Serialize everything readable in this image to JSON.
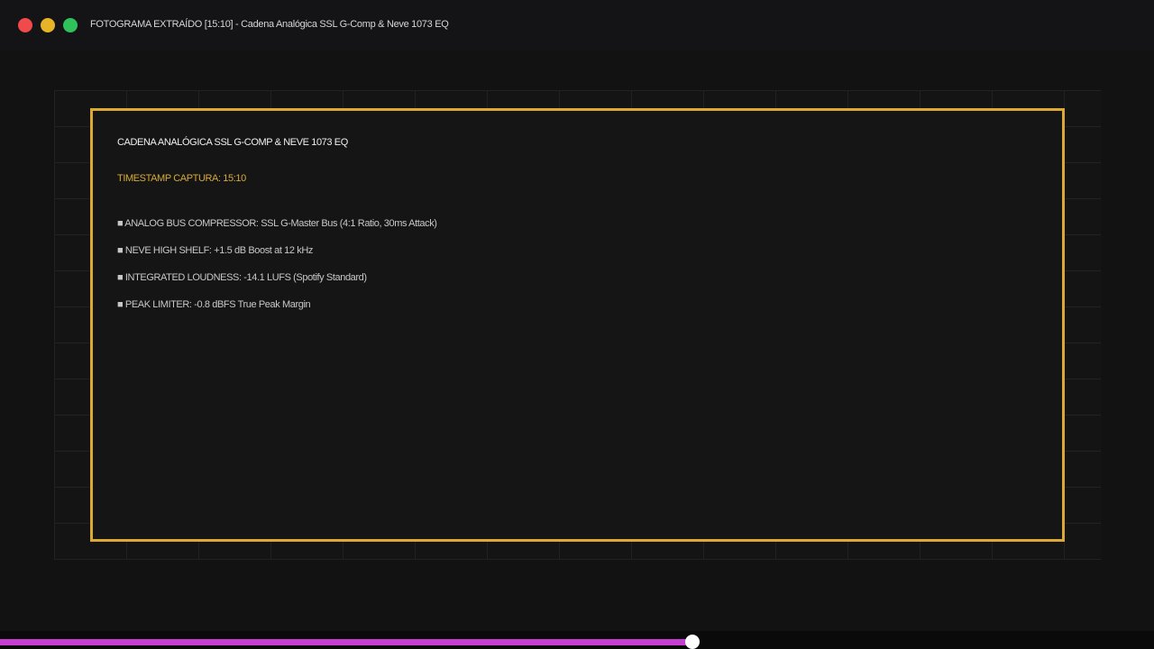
{
  "window": {
    "title": "FOTOGRAMA EXTRAÍDO [15:10] - Cadena Analógica SSL G-Comp & Neve 1073 EQ"
  },
  "frame": {
    "title": "CADENA ANALÓGICA SSL G-COMP & NEVE 1073 EQ",
    "timestamp": "TIMESTAMP CAPTURA: 15:10",
    "items": [
      {
        "label": "■ ANALOG BUS COMPRESSOR: SSL G-Master Bus (4:1 Ratio, 30ms Attack)"
      },
      {
        "label": "■ NEVE HIGH SHELF: +1.5 dB Boost at 12 kHz"
      },
      {
        "label": "■ INTEGRATED LOUDNESS: -14.1 LUFS (Spotify Standard)"
      },
      {
        "label": "■ PEAK LIMITER: -0.8 dBFS True Peak Margin"
      }
    ]
  },
  "playback": {
    "progress": 0.6
  },
  "colors": {
    "accent": "#dcaa32",
    "progress": "#c53fd3",
    "close": "#f04a4a",
    "minimize": "#e7b427",
    "maximize": "#2fc15b"
  }
}
